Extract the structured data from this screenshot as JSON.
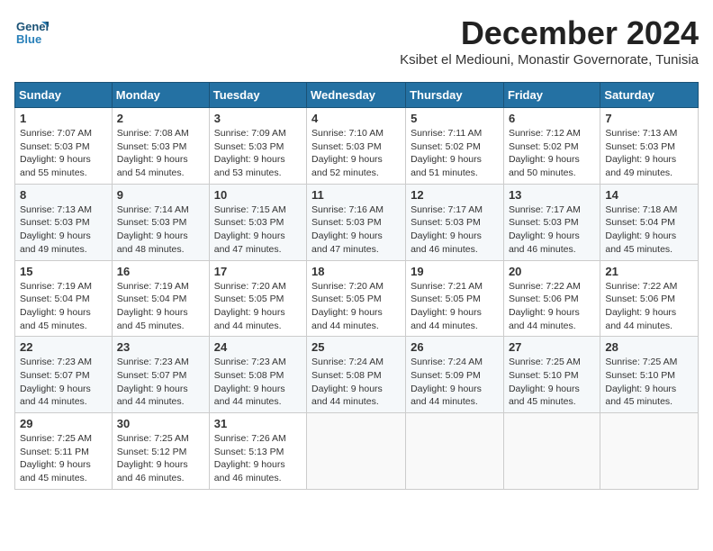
{
  "logo": {
    "line1": "General",
    "line2": "Blue"
  },
  "title": "December 2024",
  "subtitle": "Ksibet el Mediouni, Monastir Governorate, Tunisia",
  "columns": [
    "Sunday",
    "Monday",
    "Tuesday",
    "Wednesday",
    "Thursday",
    "Friday",
    "Saturday"
  ],
  "weeks": [
    [
      {
        "day": 1,
        "sunrise": "7:07 AM",
        "sunset": "5:03 PM",
        "daylight": "9 hours and 55 minutes."
      },
      {
        "day": 2,
        "sunrise": "7:08 AM",
        "sunset": "5:03 PM",
        "daylight": "9 hours and 54 minutes."
      },
      {
        "day": 3,
        "sunrise": "7:09 AM",
        "sunset": "5:03 PM",
        "daylight": "9 hours and 53 minutes."
      },
      {
        "day": 4,
        "sunrise": "7:10 AM",
        "sunset": "5:03 PM",
        "daylight": "9 hours and 52 minutes."
      },
      {
        "day": 5,
        "sunrise": "7:11 AM",
        "sunset": "5:02 PM",
        "daylight": "9 hours and 51 minutes."
      },
      {
        "day": 6,
        "sunrise": "7:12 AM",
        "sunset": "5:02 PM",
        "daylight": "9 hours and 50 minutes."
      },
      {
        "day": 7,
        "sunrise": "7:13 AM",
        "sunset": "5:03 PM",
        "daylight": "9 hours and 49 minutes."
      }
    ],
    [
      {
        "day": 8,
        "sunrise": "7:13 AM",
        "sunset": "5:03 PM",
        "daylight": "9 hours and 49 minutes."
      },
      {
        "day": 9,
        "sunrise": "7:14 AM",
        "sunset": "5:03 PM",
        "daylight": "9 hours and 48 minutes."
      },
      {
        "day": 10,
        "sunrise": "7:15 AM",
        "sunset": "5:03 PM",
        "daylight": "9 hours and 47 minutes."
      },
      {
        "day": 11,
        "sunrise": "7:16 AM",
        "sunset": "5:03 PM",
        "daylight": "9 hours and 47 minutes."
      },
      {
        "day": 12,
        "sunrise": "7:17 AM",
        "sunset": "5:03 PM",
        "daylight": "9 hours and 46 minutes."
      },
      {
        "day": 13,
        "sunrise": "7:17 AM",
        "sunset": "5:03 PM",
        "daylight": "9 hours and 46 minutes."
      },
      {
        "day": 14,
        "sunrise": "7:18 AM",
        "sunset": "5:04 PM",
        "daylight": "9 hours and 45 minutes."
      }
    ],
    [
      {
        "day": 15,
        "sunrise": "7:19 AM",
        "sunset": "5:04 PM",
        "daylight": "9 hours and 45 minutes."
      },
      {
        "day": 16,
        "sunrise": "7:19 AM",
        "sunset": "5:04 PM",
        "daylight": "9 hours and 45 minutes."
      },
      {
        "day": 17,
        "sunrise": "7:20 AM",
        "sunset": "5:05 PM",
        "daylight": "9 hours and 44 minutes."
      },
      {
        "day": 18,
        "sunrise": "7:20 AM",
        "sunset": "5:05 PM",
        "daylight": "9 hours and 44 minutes."
      },
      {
        "day": 19,
        "sunrise": "7:21 AM",
        "sunset": "5:05 PM",
        "daylight": "9 hours and 44 minutes."
      },
      {
        "day": 20,
        "sunrise": "7:22 AM",
        "sunset": "5:06 PM",
        "daylight": "9 hours and 44 minutes."
      },
      {
        "day": 21,
        "sunrise": "7:22 AM",
        "sunset": "5:06 PM",
        "daylight": "9 hours and 44 minutes."
      }
    ],
    [
      {
        "day": 22,
        "sunrise": "7:23 AM",
        "sunset": "5:07 PM",
        "daylight": "9 hours and 44 minutes."
      },
      {
        "day": 23,
        "sunrise": "7:23 AM",
        "sunset": "5:07 PM",
        "daylight": "9 hours and 44 minutes."
      },
      {
        "day": 24,
        "sunrise": "7:23 AM",
        "sunset": "5:08 PM",
        "daylight": "9 hours and 44 minutes."
      },
      {
        "day": 25,
        "sunrise": "7:24 AM",
        "sunset": "5:08 PM",
        "daylight": "9 hours and 44 minutes."
      },
      {
        "day": 26,
        "sunrise": "7:24 AM",
        "sunset": "5:09 PM",
        "daylight": "9 hours and 44 minutes."
      },
      {
        "day": 27,
        "sunrise": "7:25 AM",
        "sunset": "5:10 PM",
        "daylight": "9 hours and 45 minutes."
      },
      {
        "day": 28,
        "sunrise": "7:25 AM",
        "sunset": "5:10 PM",
        "daylight": "9 hours and 45 minutes."
      }
    ],
    [
      {
        "day": 29,
        "sunrise": "7:25 AM",
        "sunset": "5:11 PM",
        "daylight": "9 hours and 45 minutes."
      },
      {
        "day": 30,
        "sunrise": "7:25 AM",
        "sunset": "5:12 PM",
        "daylight": "9 hours and 46 minutes."
      },
      {
        "day": 31,
        "sunrise": "7:26 AM",
        "sunset": "5:13 PM",
        "daylight": "9 hours and 46 minutes."
      },
      null,
      null,
      null,
      null
    ]
  ]
}
